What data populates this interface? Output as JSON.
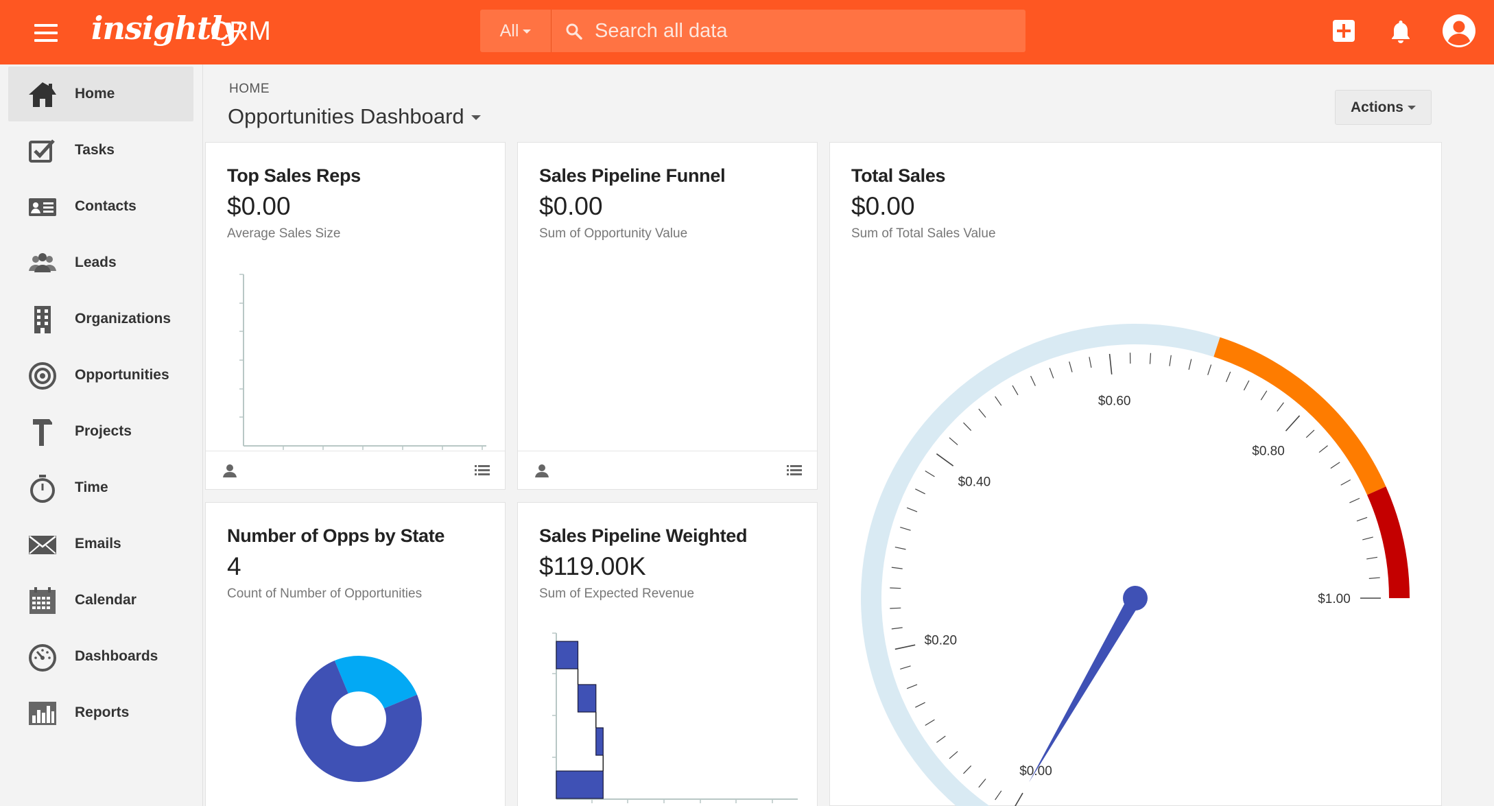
{
  "app": {
    "logo_text": "insightly",
    "product": "CRM"
  },
  "search": {
    "scope": "All",
    "placeholder": "Search all data"
  },
  "sidebar": {
    "items": [
      {
        "label": "Home",
        "icon": "home-icon",
        "active": true
      },
      {
        "label": "Tasks",
        "icon": "tasks-icon"
      },
      {
        "label": "Contacts",
        "icon": "contacts-icon"
      },
      {
        "label": "Leads",
        "icon": "leads-icon"
      },
      {
        "label": "Organizations",
        "icon": "organizations-icon"
      },
      {
        "label": "Opportunities",
        "icon": "opportunities-icon"
      },
      {
        "label": "Projects",
        "icon": "projects-icon"
      },
      {
        "label": "Time",
        "icon": "time-icon"
      },
      {
        "label": "Emails",
        "icon": "emails-icon"
      },
      {
        "label": "Calendar",
        "icon": "calendar-icon"
      },
      {
        "label": "Dashboards",
        "icon": "dashboards-icon"
      },
      {
        "label": "Reports",
        "icon": "reports-icon"
      }
    ]
  },
  "header": {
    "breadcrumb": "HOME",
    "title": "Opportunities Dashboard",
    "actions_label": "Actions"
  },
  "colors": {
    "brand": "#fe5722",
    "series_blue": "#3f51b5",
    "series_light_blue": "#03a9f4",
    "gauge_band_light": "#d9eaf3",
    "gauge_band_orange": "#fe7c00",
    "gauge_band_red": "#c40000"
  },
  "cards": {
    "top_sales_reps": {
      "title": "Top Sales Reps",
      "value": "$0.00",
      "subtitle": "Average Sales Size"
    },
    "sales_pipeline_funnel": {
      "title": "Sales Pipeline Funnel",
      "value": "$0.00",
      "subtitle": "Sum of Opportunity Value"
    },
    "total_sales": {
      "title": "Total Sales",
      "value": "$0.00",
      "subtitle": "Sum of Total Sales Value"
    },
    "opps_by_state": {
      "title": "Number of Opps by State",
      "value": "4",
      "subtitle": "Count of Number of Opportunities"
    },
    "sales_pipeline_weighted": {
      "title": "Sales Pipeline Weighted",
      "value": "$119.00K",
      "subtitle": "Sum of Expected Revenue"
    }
  },
  "chart_data": [
    {
      "type": "bar",
      "title": "Top Sales Reps",
      "categories": [],
      "values": []
    },
    {
      "type": "gauge",
      "title": "Total Sales",
      "min": 0,
      "max": 1,
      "tick_labels": [
        "$0.00",
        "$0.20",
        "$0.40",
        "$0.60",
        "$0.80",
        "$1.00"
      ],
      "tick_values": [
        0,
        0.2,
        0.4,
        0.6,
        0.8,
        1.0
      ],
      "value": 0,
      "bands": [
        {
          "from": 0,
          "to": 0.7,
          "color": "#d9eaf3"
        },
        {
          "from": 0.7,
          "to": 0.9,
          "color": "#fe7c00"
        },
        {
          "from": 0.9,
          "to": 1.0,
          "color": "#c40000"
        }
      ]
    },
    {
      "type": "pie",
      "title": "Number of Opps by State",
      "slices": [
        {
          "value": 1,
          "color": "#03a9f4"
        },
        {
          "value": 3,
          "color": "#3f51b5"
        }
      ]
    },
    {
      "type": "waterfall",
      "title": "Sales Pipeline Weighted",
      "values": [
        30,
        25,
        10,
        54
      ],
      "color": "#3f51b5"
    }
  ]
}
